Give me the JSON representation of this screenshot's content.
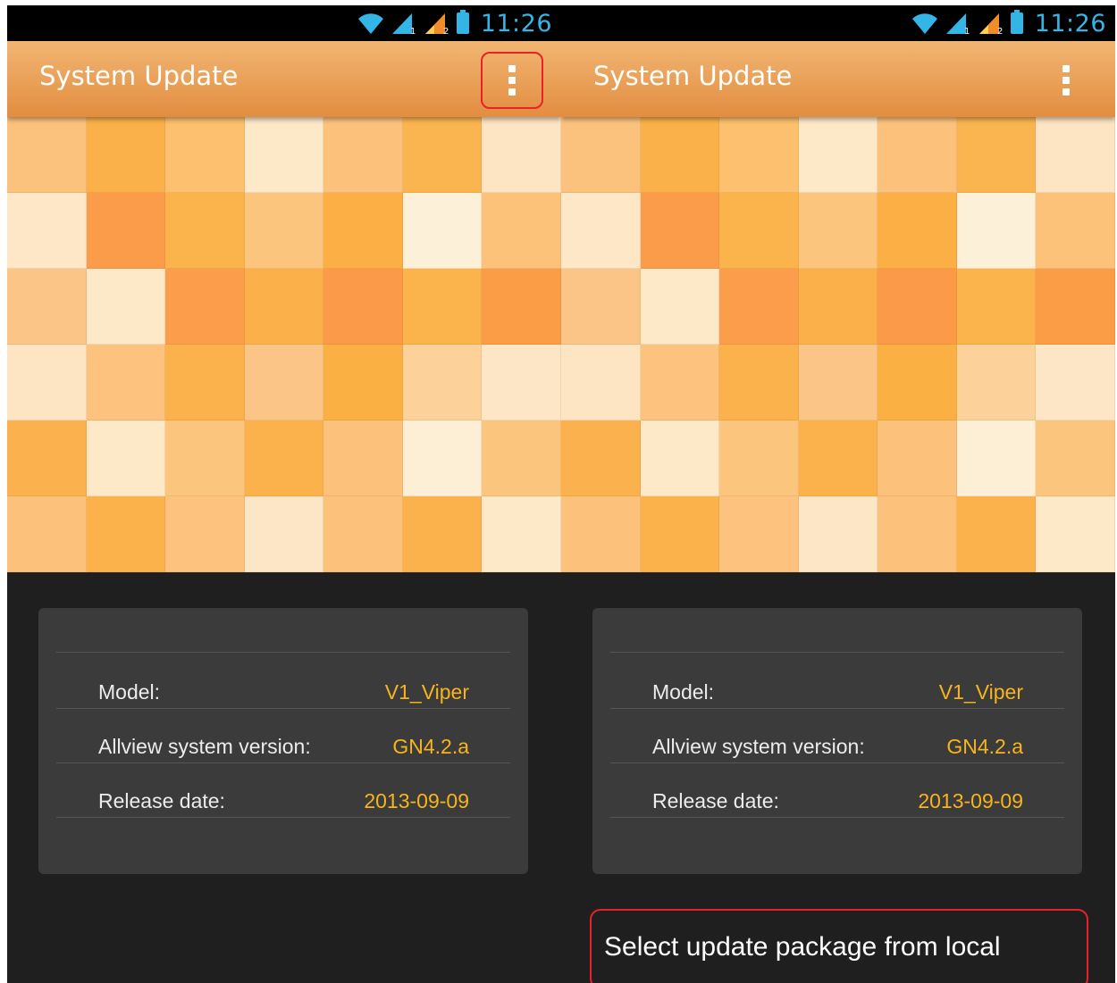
{
  "status_bar": {
    "time": "11:26",
    "icons": [
      "wifi-icon",
      "signal-sim1-icon",
      "signal-sim2-icon",
      "battery-icon"
    ]
  },
  "colors": {
    "accent": "#33b5e5",
    "actionbar": "#e99a4f",
    "value": "#f7b41c",
    "highlight": "#e8212a",
    "tiles": [
      [
        "#fbc27e",
        "#fab14a",
        "#fcc06e",
        "#fde8c8",
        "#fcc27c",
        "#fbb550",
        "#fde4c2"
      ],
      [
        "#fde7c6",
        "#fb9c4a",
        "#fbb44c",
        "#fcc57e",
        "#fbaf44",
        "#fdf0d8",
        "#fcc27a"
      ],
      [
        "#fcc588",
        "#fde8c8",
        "#fb9d4a",
        "#fbb04a",
        "#fb9a48",
        "#fbb44c",
        "#fb9c46"
      ],
      [
        "#fde4c2",
        "#fcc27e",
        "#fbb24c",
        "#fcc588",
        "#fbb044",
        "#fdd29a",
        "#fde6c6"
      ],
      [
        "#fbb24e",
        "#fde8c8",
        "#fcc57e",
        "#fbb24c",
        "#fcc27c",
        "#fdeed6",
        "#fcc57e"
      ],
      [
        "#fcc27c",
        "#fbb24a",
        "#fcc27e",
        "#fde6c6",
        "#fcc27c",
        "#fbb24c",
        "#fde8c8"
      ]
    ]
  },
  "left_screen": {
    "title": "System Update",
    "menu_icon": "overflow-menu-icon",
    "info": [
      {
        "label": "Model:",
        "value": "V1_Viper"
      },
      {
        "label": "Allview system version:",
        "value": "GN4.2.a"
      },
      {
        "label": "Release date:",
        "value": "2013-09-09"
      }
    ]
  },
  "right_screen": {
    "title": "System Update",
    "menu_icon": "overflow-menu-icon",
    "info": [
      {
        "label": "Model:",
        "value": "V1_Viper"
      },
      {
        "label": "Allview system version:",
        "value": "GN4.2.a"
      },
      {
        "label": "Release date:",
        "value": "2013-09-09"
      }
    ],
    "menu_item": "Select update package from local"
  }
}
